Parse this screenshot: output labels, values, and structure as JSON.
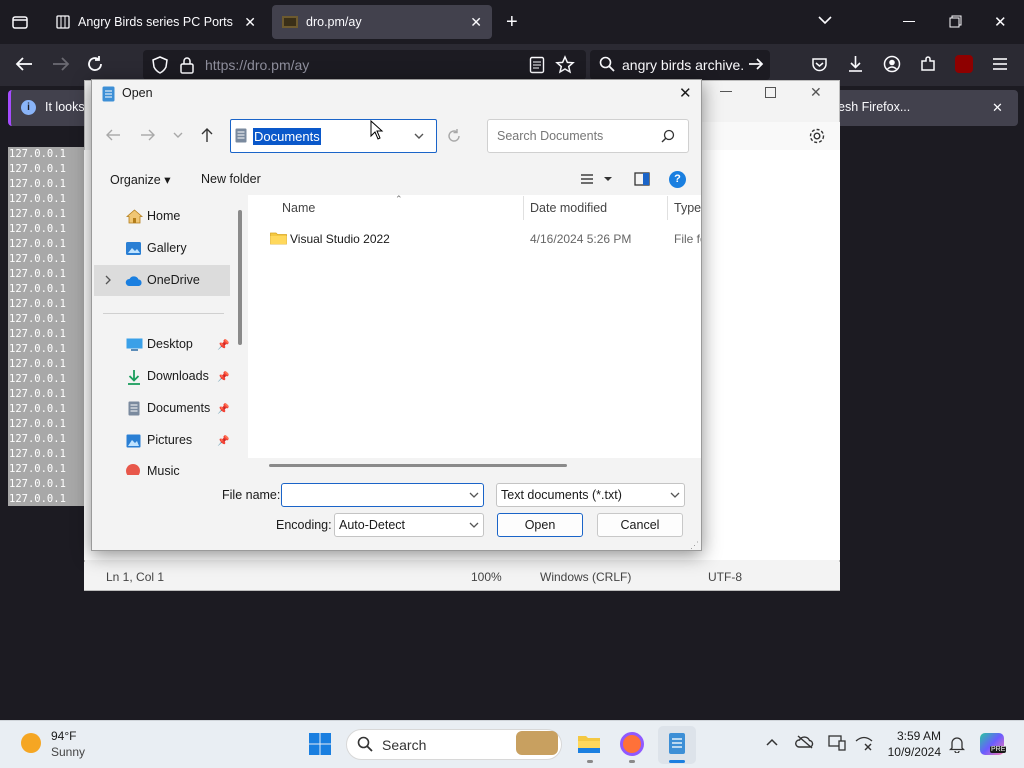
{
  "browser": {
    "tabs": [
      {
        "title": "Angry Birds series PC Ports : Ro"
      },
      {
        "title": "dro.pm/ay"
      }
    ],
    "url_prefix": "https://",
    "url_host": "dro.pm/ay",
    "search_text": "angry birds archive.",
    "notification_text": "It looks",
    "notification_button": "esh Firefox..."
  },
  "page": {
    "log_lines": [
      "127.0.0.1",
      "127.0.0.1",
      "127.0.0.1",
      "127.0.0.1",
      "127.0.0.1",
      "127.0.0.1",
      "127.0.0.1",
      "127.0.0.1",
      "127.0.0.1",
      "127.0.0.1",
      "127.0.0.1",
      "127.0.0.1",
      "127.0.0.1",
      "127.0.0.1",
      "127.0.0.1",
      "127.0.0.1",
      "127.0.0.1",
      "127.0.0.1",
      "127.0.0.1",
      "127.0.0.1",
      "127.0.0.1",
      "127.0.0.1",
      "127.0.0.1",
      "127.0.0.1"
    ]
  },
  "notepad": {
    "status": {
      "position": "Ln 1, Col 1",
      "zoom": "100%",
      "line_ending": "Windows (CRLF)",
      "encoding": "UTF-8"
    }
  },
  "dialog": {
    "title": "Open",
    "address": "Documents",
    "search_placeholder": "Search Documents",
    "organize_label": "Organize",
    "new_folder_label": "New folder",
    "nav": {
      "home": "Home",
      "gallery": "Gallery",
      "onedrive": "OneDrive",
      "desktop": "Desktop",
      "downloads": "Downloads",
      "documents": "Documents",
      "pictures": "Pictures",
      "music": "Music"
    },
    "columns": {
      "name": "Name",
      "date": "Date modified",
      "type": "Type"
    },
    "files": [
      {
        "name": "Visual Studio 2022",
        "date": "4/16/2024 5:26 PM",
        "type": "File fo"
      }
    ],
    "file_name_label": "File name:",
    "file_name_value": "",
    "file_type": "Text documents (*.txt)",
    "encoding_label": "Encoding:",
    "encoding_value": "Auto-Detect",
    "open_label": "Open",
    "cancel_label": "Cancel"
  },
  "taskbar": {
    "weather_temp": "94°F",
    "weather_cond": "Sunny",
    "search_label": "Search",
    "time": "3:59 AM",
    "date": "10/9/2024",
    "copilot_badge": "PRE"
  },
  "colors": {
    "accent": "#0a58ca",
    "firefox_bg": "#1c1b22",
    "notification_accent": "#a54cff"
  }
}
